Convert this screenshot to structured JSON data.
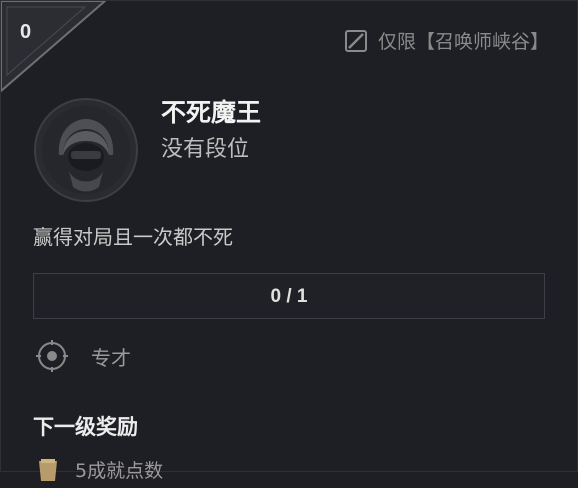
{
  "header": {
    "level": "0",
    "restriction_label": "仅限【召唤师峡谷】"
  },
  "challenge": {
    "title": "不死魔王",
    "rank": "没有段位",
    "description": "赢得对局且一次都不死"
  },
  "progress": {
    "current": 0,
    "total": 1,
    "label": "0 / 1"
  },
  "category": {
    "label": "专才"
  },
  "next_reward": {
    "heading": "下一级奖励",
    "item_label": "5成就点数"
  },
  "icons": {
    "restriction": "map-restriction-icon",
    "avatar": "hooded-figure-icon",
    "category": "target-icon",
    "reward": "points-icon"
  },
  "colors": {
    "background": "#1e1f24",
    "accent_gold": "#c8aa6e"
  }
}
